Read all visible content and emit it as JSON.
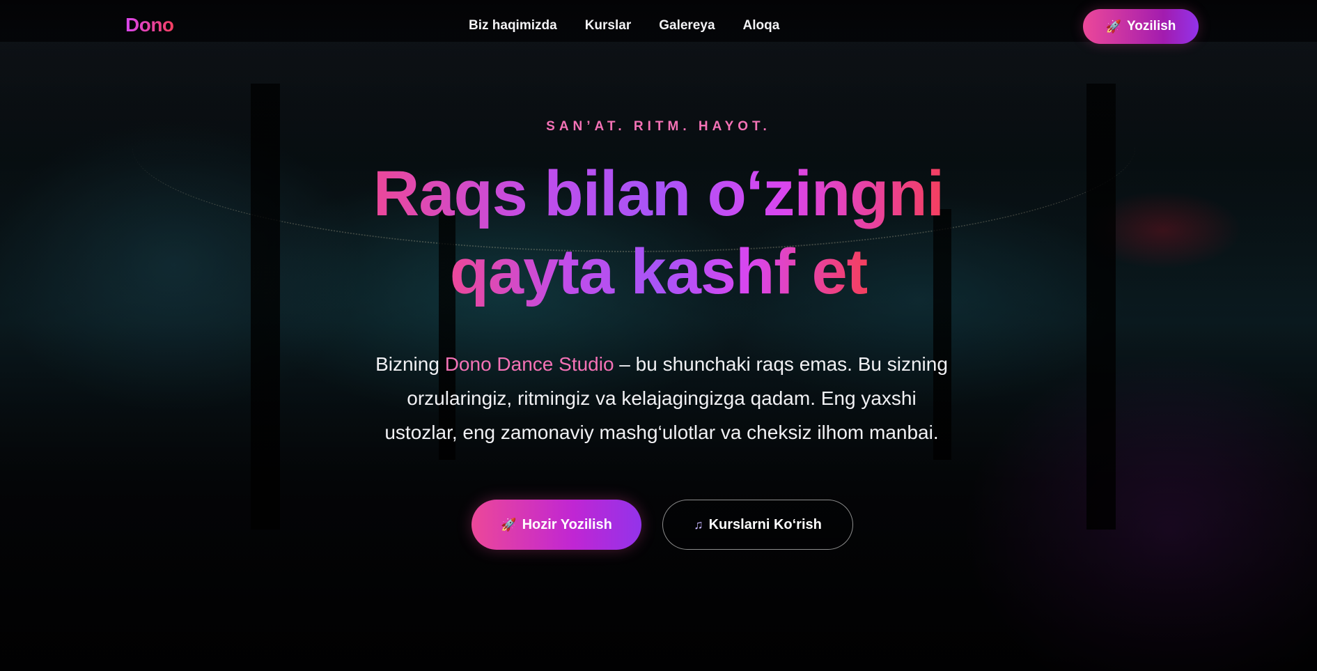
{
  "header": {
    "logo": "Dono",
    "nav": [
      {
        "label": "Biz haqimizda"
      },
      {
        "label": "Kurslar"
      },
      {
        "label": "Galereya"
      },
      {
        "label": "Aloqa"
      }
    ],
    "cta": {
      "icon": "rocket-icon",
      "glyph": "🚀",
      "label": "Yozilish"
    }
  },
  "hero": {
    "tagline": "SAN’AT. RITM. HAYOT.",
    "headline_line1": "Raqs bilan o‘zingni",
    "headline_line2": "qayta kashf et",
    "description_prefix": "Bizning ",
    "description_brand": "Dono Dance Studio",
    "description_suffix": " – bu shunchaki raqs emas. Bu sizning orzularingiz, ritmingiz va kelajagingizga qadam. Eng yaxshi ustozlar, eng zamonaviy mashg‘ulotlar va cheksiz ilhom manbai.",
    "primary_button": {
      "icon": "rocket-icon",
      "glyph": "🚀",
      "label": "Hozir Yozilish"
    },
    "secondary_button": {
      "icon": "music-note-icon",
      "glyph": "♫",
      "label": "Kurslarni Ko‘rish"
    }
  },
  "colors": {
    "accent_pink": "#ec4899",
    "accent_purple": "#9333ea",
    "accent_red": "#f43f5e",
    "tagline": "#f472b6",
    "background": "#05040a"
  }
}
